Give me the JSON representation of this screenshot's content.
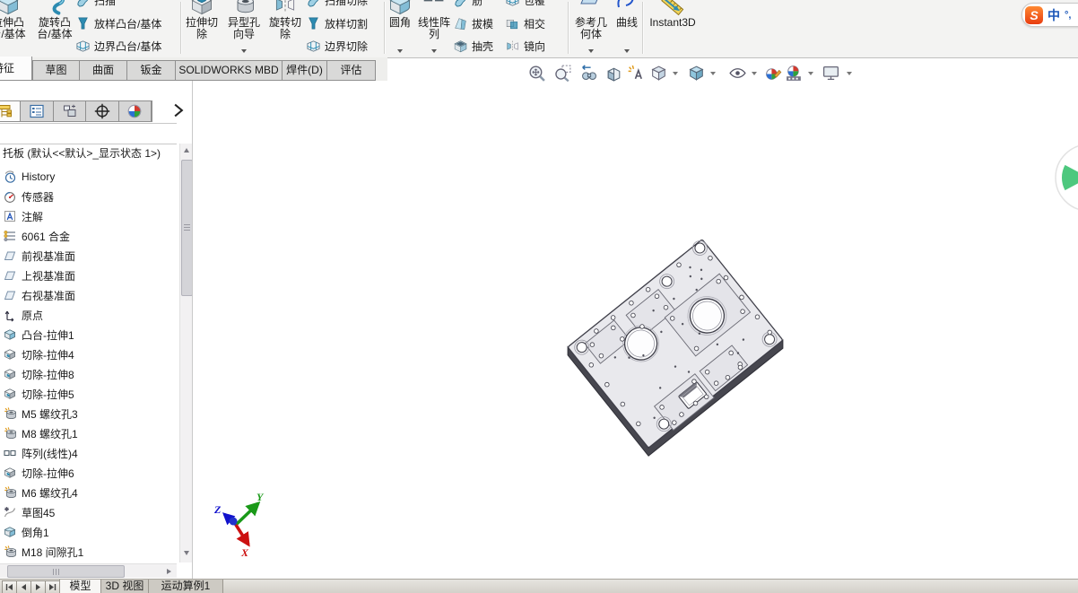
{
  "ribbon": {
    "features_group1": {
      "extrude_boss": "拉伸凸台/基体",
      "revolve_boss": "旋转凸台/基体",
      "sweep": "扫描",
      "loft_boss": "放样凸台/基体",
      "boundary_boss": "边界凸台/基体"
    },
    "cut_group": {
      "extrude_cut": "拉伸切除",
      "hole_wizard": "异型孔向导",
      "revolve_cut": "旋转切除",
      "sweep_cut": "扫描切除",
      "loft_cut": "放样切割",
      "boundary_cut": "边界切除"
    },
    "feature_tools_group": {
      "fillet": "圆角",
      "linear_pattern": "线性阵列",
      "rib": "筋",
      "draft": "拔模",
      "shell": "抽壳",
      "wrap": "包覆",
      "intersect": "相交",
      "mirror": "镜向"
    },
    "reference_group": {
      "reference_geometry": "参考几何体",
      "curves": "曲线"
    },
    "instant3d": "Instant3D"
  },
  "command_tabs": {
    "features": "特征",
    "sketch": "草图",
    "surfaces": "曲面",
    "sheet_metal": "钣金",
    "mbd": "SOLIDWORKS MBD",
    "weldments": "焊件(D)",
    "evaluate": "评估"
  },
  "feature_tree": {
    "root": "托板 (默认<<默认>_显示状态 1>)",
    "items": [
      "History",
      "传感器",
      "注解",
      "6061 合金",
      "前视基准面",
      "上视基准面",
      "右视基准面",
      "原点",
      "凸台-拉伸1",
      "切除-拉伸4",
      "切除-拉伸8",
      "切除-拉伸5",
      "M5 螺纹孔3",
      "M8 螺纹孔1",
      "阵列(线性)4",
      "切除-拉伸6",
      "M6 螺纹孔4",
      "草图45",
      "倒角1",
      "M18 间隙孔1"
    ]
  },
  "status_bar": {
    "model_tab": "模型",
    "view_3d_tab": "3D 视图",
    "motion_study_tab": "运动算例1"
  },
  "ime": {
    "logo": "S",
    "mode": "中",
    "punctuation": "°,"
  },
  "triad": {
    "x": "X",
    "y": "Y",
    "z": "Z"
  },
  "colors": {
    "accent_teal": "#2d8bb1",
    "part_face": "#e9e9ed",
    "part_edge": "#3f3f49",
    "triad_x": "#cc1111",
    "triad_y": "#1a9918",
    "triad_z": "#1111cc",
    "ime_orange": "#f05a23",
    "ime_blue": "#1a56b8"
  }
}
